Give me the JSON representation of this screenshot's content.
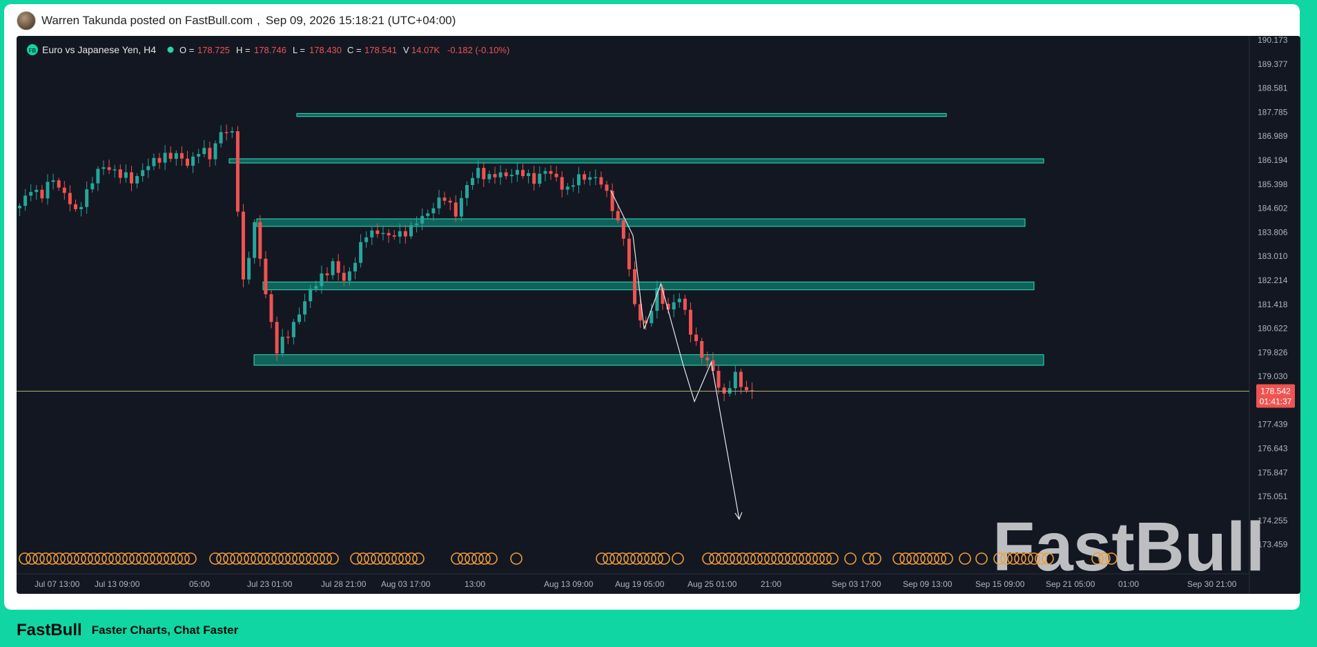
{
  "post": {
    "author_line": "Warren Takunda posted on FastBull.com",
    "separator": ",",
    "datetime": "Sep 09, 2026 15:18:21 (UTC+04:00)"
  },
  "footer": {
    "brand": "FastBull",
    "tagline": "Faster Charts, Chat Faster"
  },
  "legend": {
    "badge": "FB",
    "symbol": "Euro vs Japanese Yen, H4",
    "o_label": "O =",
    "o_value": "178.725",
    "h_label": "H =",
    "h_value": "178.746",
    "l_label": "L =",
    "l_value": "178.430",
    "c_label": "C =",
    "c_value": "178.541",
    "v_label": "V",
    "v_value": "14.07K",
    "change": "-0.182 (-0.10%)"
  },
  "colors": {
    "background": "#131722",
    "up": "#26a69a",
    "down": "#ef5350",
    "zone_fill": "#0fa38a",
    "zone_stroke": "#2fe0bd",
    "price_line": "#b5b37a",
    "event_marker": "#f29d38",
    "accent": "#10d6a3"
  },
  "watermark": "FastBull",
  "chart_data": {
    "type": "candlestick",
    "timeframe": "H4",
    "y_axis_ticks": [
      "190.173",
      "189.377",
      "188.581",
      "187.785",
      "186.989",
      "186.194",
      "185.398",
      "184.602",
      "183.806",
      "183.010",
      "182.214",
      "181.418",
      "180.622",
      "179.826",
      "179.030",
      "177.439",
      "176.643",
      "175.847",
      "175.051",
      "174.255",
      "173.459"
    ],
    "ylim": [
      172.9,
      190.2
    ],
    "x_axis_ticks": [
      "Jul 07 13:00",
      "Jul 13 09:00",
      "05:00",
      "Jul 23 01:00",
      "Jul 28 21:00",
      "Aug 03 17:00",
      "13:00",
      "Aug 13 09:00",
      "Aug 19 05:00",
      "Aug 25 01:00",
      "21:00",
      "Sep 03 17:00",
      "Sep 09 13:00",
      "Sep 15 09:00",
      "Sep 21 05:00",
      "01:00",
      "Sep 30 21:00"
    ],
    "current_price": "178.542",
    "countdown": "01:41:37",
    "price_path": [
      [
        0,
        184.6
      ],
      [
        2,
        185.3
      ],
      [
        4,
        185.0
      ],
      [
        6,
        185.6
      ],
      [
        8,
        185.1
      ],
      [
        10,
        184.4
      ],
      [
        12,
        185.2
      ],
      [
        14,
        185.8
      ],
      [
        16,
        186.0
      ],
      [
        18,
        185.7
      ],
      [
        20,
        185.5
      ],
      [
        22,
        185.9
      ],
      [
        24,
        186.1
      ],
      [
        26,
        186.4
      ],
      [
        28,
        186.3
      ],
      [
        30,
        186.1
      ],
      [
        32,
        186.5
      ],
      [
        34,
        186.3
      ],
      [
        36,
        187.2
      ],
      [
        38,
        187.0
      ],
      [
        40,
        182.2
      ],
      [
        42,
        184.0
      ],
      [
        44,
        181.8
      ],
      [
        46,
        179.9
      ],
      [
        48,
        180.4
      ],
      [
        50,
        181.2
      ],
      [
        52,
        181.8
      ],
      [
        54,
        182.4
      ],
      [
        56,
        182.7
      ],
      [
        58,
        182.2
      ],
      [
        60,
        182.9
      ],
      [
        62,
        183.7
      ],
      [
        64,
        183.9
      ],
      [
        66,
        183.6
      ],
      [
        68,
        183.8
      ],
      [
        70,
        183.9
      ],
      [
        72,
        184.3
      ],
      [
        74,
        184.7
      ],
      [
        76,
        184.9
      ],
      [
        78,
        184.5
      ],
      [
        80,
        185.3
      ],
      [
        82,
        185.9
      ],
      [
        84,
        185.6
      ],
      [
        86,
        185.7
      ],
      [
        88,
        185.8
      ],
      [
        90,
        185.7
      ],
      [
        92,
        185.6
      ],
      [
        94,
        185.8
      ],
      [
        96,
        185.6
      ],
      [
        98,
        185.2
      ],
      [
        100,
        185.6
      ],
      [
        102,
        185.7
      ],
      [
        104,
        185.4
      ],
      [
        106,
        184.7
      ],
      [
        108,
        183.6
      ],
      [
        110,
        181.4
      ],
      [
        112,
        180.7
      ],
      [
        114,
        181.8
      ],
      [
        116,
        181.3
      ],
      [
        118,
        181.6
      ],
      [
        120,
        180.6
      ],
      [
        122,
        179.7
      ],
      [
        124,
        179.2
      ],
      [
        126,
        178.4
      ],
      [
        128,
        179.0
      ],
      [
        130,
        178.6
      ],
      [
        131,
        178.54
      ]
    ],
    "horizontal_zones": [
      {
        "from": "Jul 23 01:00",
        "to": "beyond Sep 09",
        "low": 186.1,
        "high": 186.24
      },
      {
        "from": "Jul 23 01:00",
        "to": "beyond Sep 09",
        "low": 184.0,
        "high": 184.25
      },
      {
        "from": "Jul 23 01:00",
        "to": "beyond Sep 09",
        "low": 181.9,
        "high": 182.16
      },
      {
        "from": "Jul 23 01:00",
        "to": "beyond Sep 09",
        "low": 179.4,
        "high": 179.75
      },
      {
        "from": "Jul 23 01:00",
        "to": "Sep 09",
        "low": 187.64,
        "high": 187.74
      }
    ],
    "forecast_path": [
      [
        106,
        185.2
      ],
      [
        110,
        183.7
      ],
      [
        112,
        180.6
      ],
      [
        115,
        182.1
      ],
      [
        119,
        179.4
      ],
      [
        121,
        178.2
      ],
      [
        124,
        179.5
      ],
      [
        129,
        174.3
      ]
    ],
    "event_markers_count": 110
  }
}
